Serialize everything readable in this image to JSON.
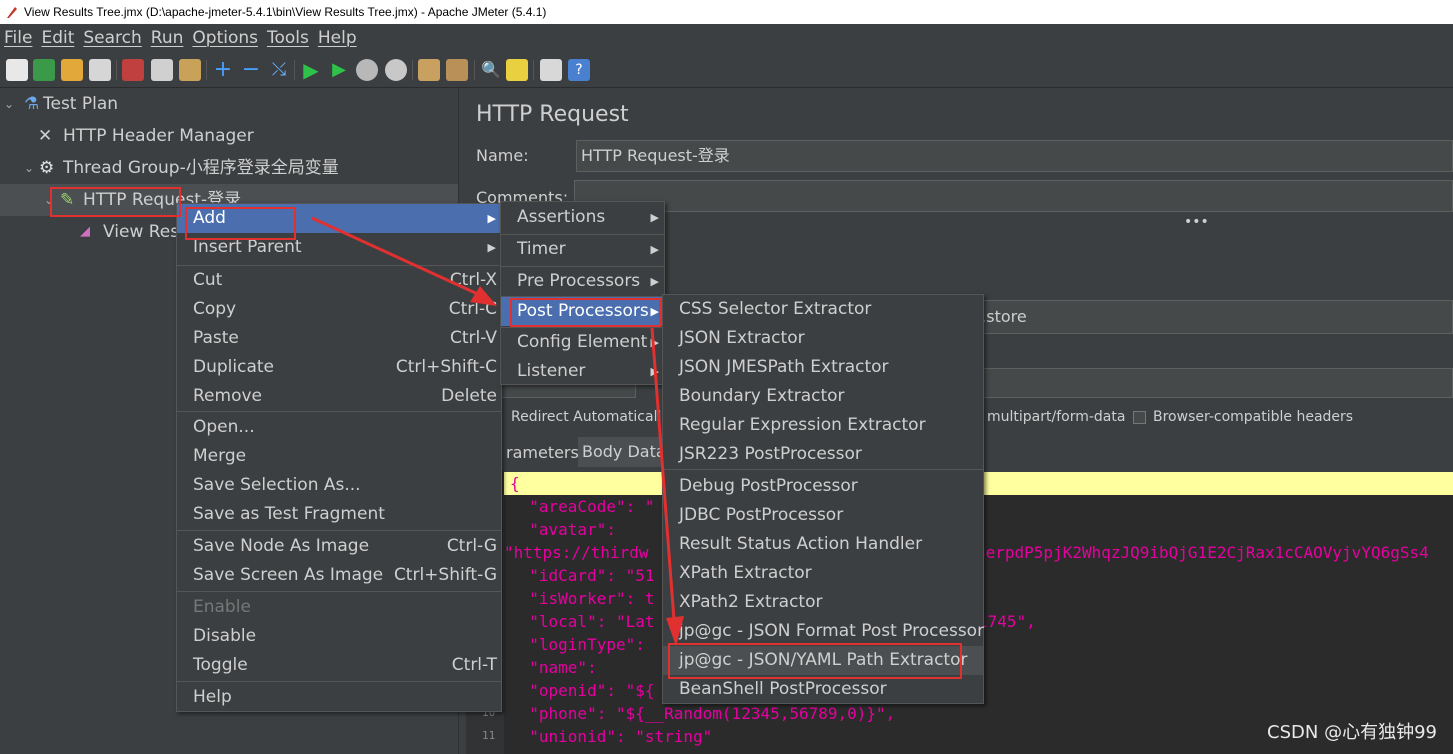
{
  "window": {
    "title": "View Results Tree.jmx (D:\\apache-jmeter-5.4.1\\bin\\View Results Tree.jmx) - Apache JMeter (5.4.1)"
  },
  "menubar": [
    "File",
    "Edit",
    "Search",
    "Run",
    "Options",
    "Tools",
    "Help"
  ],
  "tree": {
    "test_plan": "Test Plan",
    "header_manager": "HTTP Header Manager",
    "thread_group": "Thread Group-小程序登录全局变量",
    "http_request": "HTTP Request-登录",
    "view_results": "View Results Tree"
  },
  "panel": {
    "title": "HTTP Request",
    "name_label": "Name:",
    "name_value": "HTTP Request-登录",
    "comments_label": "Comments:",
    "server_fragment": "n.store",
    "redirect_label": "Redirect Automatically",
    "multipart_label": "multipart/form-data",
    "browser_headers_label": "Browser-compatible headers",
    "tab_parameters": "rameters",
    "tab_body": "Body Data"
  },
  "editor": {
    "line_numbers": [
      "10",
      "11"
    ],
    "lines": [
      "{",
      "  \"areaCode\": \"",
      "  \"avatar\":",
      "\"https://thirdw",
      "  \"idCard\": \"51",
      "  \"isWorker\": t",
      "  \"local\": \"Lat",
      "  \"loginType\":",
      "  \"name\":",
      "  \"openid\": \"${",
      "  \"phone\": \"${__Random(12345,56789,0)}\",",
      "  \"unionid\": \"string\""
    ],
    "avatar_tail": "3erpdP5pjK2WhqzJQ9ibQjG1E2CjRax1cCAOVyjvYQ6gSs4",
    "local_tail": "1745\","
  },
  "context_menu": [
    {
      "label": "Add",
      "shortcut": "",
      "submenu": true,
      "highlighted": true
    },
    {
      "label": "Insert Parent",
      "shortcut": "",
      "submenu": true
    },
    {
      "label": "Cut",
      "shortcut": "Ctrl-X"
    },
    {
      "label": "Copy",
      "shortcut": "Ctrl-C"
    },
    {
      "label": "Paste",
      "shortcut": "Ctrl-V"
    },
    {
      "label": "Duplicate",
      "shortcut": "Ctrl+Shift-C"
    },
    {
      "label": "Remove",
      "shortcut": "Delete"
    },
    {
      "label": "Open...",
      "shortcut": ""
    },
    {
      "label": "Merge",
      "shortcut": ""
    },
    {
      "label": "Save Selection As...",
      "shortcut": ""
    },
    {
      "label": "Save as Test Fragment",
      "shortcut": ""
    },
    {
      "label": "Save Node As Image",
      "shortcut": "Ctrl-G"
    },
    {
      "label": "Save Screen As Image",
      "shortcut": "Ctrl+Shift-G"
    },
    {
      "label": "Enable",
      "shortcut": "",
      "disabled": true
    },
    {
      "label": "Disable",
      "shortcut": ""
    },
    {
      "label": "Toggle",
      "shortcut": "Ctrl-T"
    },
    {
      "label": "Help",
      "shortcut": ""
    }
  ],
  "add_submenu": [
    "Assertions",
    "Timer",
    "Pre Processors",
    "Post Processors",
    "Config Element",
    "Listener"
  ],
  "post_processors": [
    "CSS Selector Extractor",
    "JSON Extractor",
    "JSON JMESPath Extractor",
    "Boundary Extractor",
    "Regular Expression Extractor",
    "JSR223 PostProcessor",
    "Debug PostProcessor",
    "JDBC PostProcessor",
    "Result Status Action Handler",
    "XPath Extractor",
    "XPath2 Extractor",
    "jp@gc - JSON Format Post Processor",
    "jp@gc - JSON/YAML Path Extractor",
    "BeanShell PostProcessor"
  ],
  "watermark": "CSDN @心有独钟99",
  "colors": {
    "background": "#3c3f41",
    "highlight": "#4b6eaf",
    "annotation_red": "#e03030",
    "json_key": "#e600a0",
    "current_line": "#ffffa0"
  }
}
